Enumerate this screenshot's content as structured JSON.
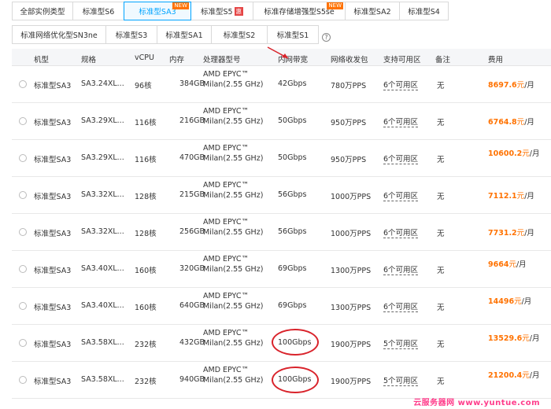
{
  "tabs_row1": [
    {
      "label": "全部实例类型",
      "active": false
    },
    {
      "label": "标准型S6",
      "active": false
    },
    {
      "label": "标准型SA3",
      "active": true,
      "badge": "NEW"
    },
    {
      "label": "标准型S5",
      "active": false,
      "badge_hot": "惠"
    },
    {
      "label": "标准存储增强型S5se",
      "active": false,
      "badge": "NEW"
    },
    {
      "label": "标准型SA2",
      "active": false
    },
    {
      "label": "标准型S4",
      "active": false
    }
  ],
  "tabs_row2": [
    {
      "label": "标准网络优化型SN3ne"
    },
    {
      "label": "标准型S3"
    },
    {
      "label": "标准型SA1"
    },
    {
      "label": "标准型S2"
    },
    {
      "label": "标准型S1"
    }
  ],
  "help_icon": "?",
  "columns": {
    "type": "机型",
    "spec": "规格",
    "vcpu": "vCPU",
    "mem": "内存",
    "cpu": "处理器型号",
    "bw": "内网带宽",
    "pps": "网络收发包",
    "zone": "支持可用区",
    "note": "备注",
    "price": "费用"
  },
  "rows": [
    {
      "type": "标准型SA3",
      "spec": "SA3.24XL...",
      "vcpu": "96核",
      "mem": "384GB",
      "cpu": "AMD EPYC™ Milan(2.55 GHz)",
      "bw": "42Gbps",
      "pps": "780万PPS",
      "zone": "6个可用区",
      "note": "无",
      "price": "8697.6",
      "unit": "元",
      "per": "/月"
    },
    {
      "type": "标准型SA3",
      "spec": "SA3.29XL...",
      "vcpu": "116核",
      "mem": "216GB",
      "cpu": "AMD EPYC™ Milan(2.55 GHz)",
      "bw": "50Gbps",
      "pps": "950万PPS",
      "zone": "6个可用区",
      "note": "无",
      "price": "6764.8",
      "unit": "元",
      "per": "/月"
    },
    {
      "type": "标准型SA3",
      "spec": "SA3.29XL...",
      "vcpu": "116核",
      "mem": "470GB",
      "cpu": "AMD EPYC™ Milan(2.55 GHz)",
      "bw": "50Gbps",
      "pps": "950万PPS",
      "zone": "6个可用区",
      "note": "无",
      "price": "10600.2",
      "unit": "元",
      "per": "/月"
    },
    {
      "type": "标准型SA3",
      "spec": "SA3.32XL...",
      "vcpu": "128核",
      "mem": "215GB",
      "cpu": "AMD EPYC™ Milan(2.55 GHz)",
      "bw": "56Gbps",
      "pps": "1000万PPS",
      "zone": "6个可用区",
      "note": "无",
      "price": "7112.1",
      "unit": "元",
      "per": "/月"
    },
    {
      "type": "标准型SA3",
      "spec": "SA3.32XL...",
      "vcpu": "128核",
      "mem": "256GB",
      "cpu": "AMD EPYC™ Milan(2.55 GHz)",
      "bw": "56Gbps",
      "pps": "1000万PPS",
      "zone": "6个可用区",
      "note": "无",
      "price": "7731.2",
      "unit": "元",
      "per": "/月"
    },
    {
      "type": "标准型SA3",
      "spec": "SA3.40XL...",
      "vcpu": "160核",
      "mem": "320GB",
      "cpu": "AMD EPYC™ Milan(2.55 GHz)",
      "bw": "69Gbps",
      "pps": "1300万PPS",
      "zone": "6个可用区",
      "note": "无",
      "price": "9664",
      "unit": "元",
      "per": "/月"
    },
    {
      "type": "标准型SA3",
      "spec": "SA3.40XL...",
      "vcpu": "160核",
      "mem": "640GB",
      "cpu": "AMD EPYC™ Milan(2.55 GHz)",
      "bw": "69Gbps",
      "pps": "1300万PPS",
      "zone": "6个可用区",
      "note": "无",
      "price": "14496",
      "unit": "元",
      "per": "/月"
    },
    {
      "type": "标准型SA3",
      "spec": "SA3.58XL...",
      "vcpu": "232核",
      "mem": "432GB",
      "cpu": "AMD EPYC™ Milan(2.55 GHz)",
      "bw": "100Gbps",
      "pps": "1900万PPS",
      "zone": "5个可用区",
      "note": "无",
      "price": "13529.6",
      "unit": "元",
      "per": "/月"
    },
    {
      "type": "标准型SA3",
      "spec": "SA3.58XL...",
      "vcpu": "232核",
      "mem": "940GB",
      "cpu": "AMD EPYC™ Milan(2.55 GHz)",
      "bw": "100Gbps",
      "pps": "1900万PPS",
      "zone": "5个可用区",
      "note": "无",
      "price": "21200.4",
      "unit": "元",
      "per": "/月"
    }
  ],
  "watermark": "云服务器网 www.yuntue.com",
  "colors": {
    "accent": "#00a4ff",
    "price": "#ff7200",
    "annotation": "#d9232b",
    "watermark": "#ff3d8b"
  }
}
